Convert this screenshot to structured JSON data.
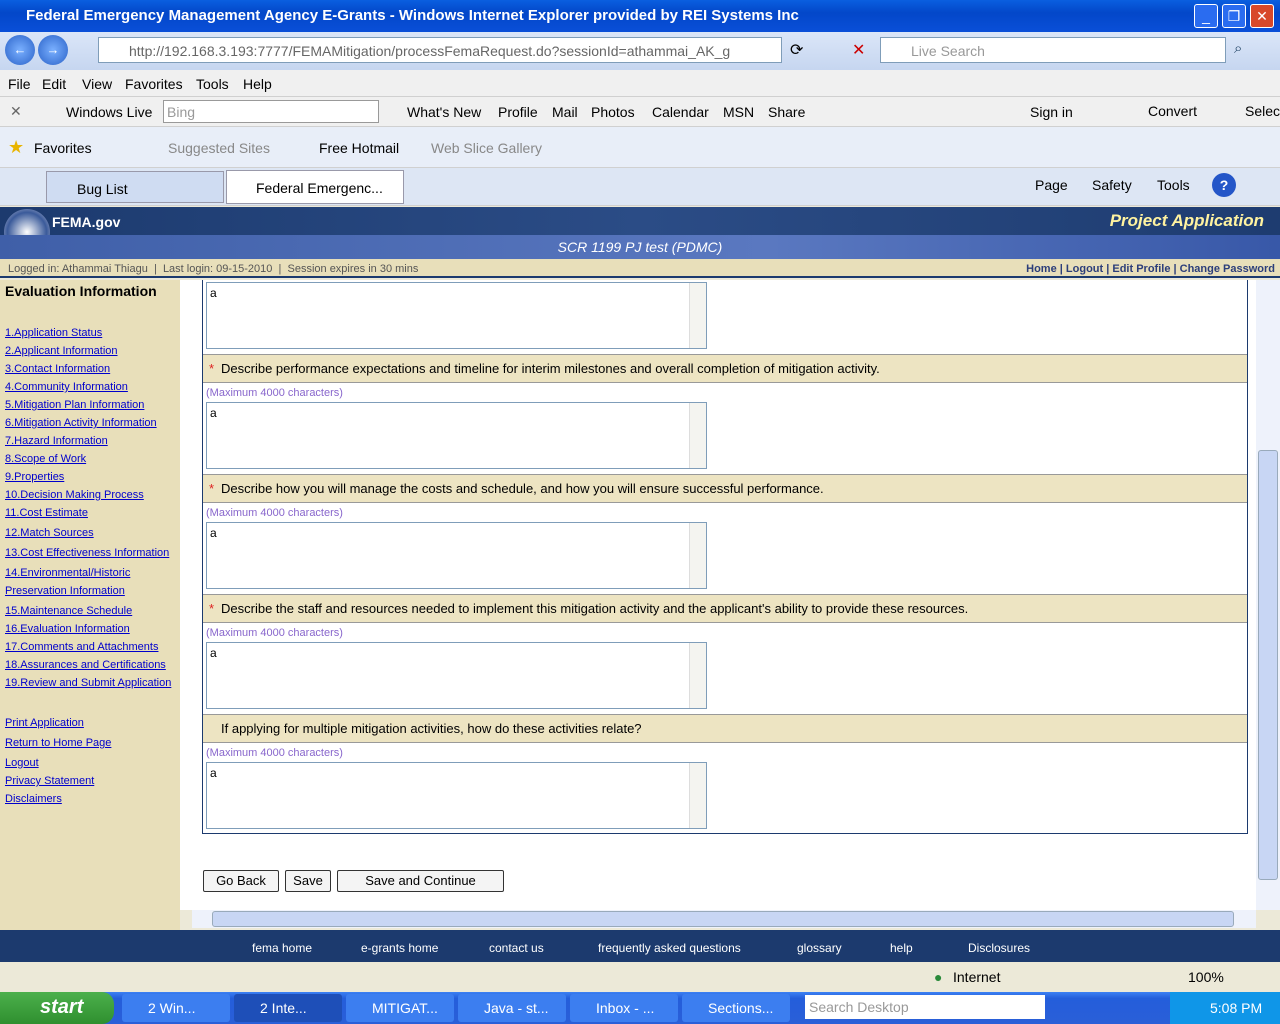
{
  "window": {
    "title": "Federal Emergency Management Agency E-Grants - Windows Internet Explorer provided by REI Systems Inc"
  },
  "address": {
    "url": "http://192.168.3.193:7777/FEMAMitigation/processFemaRequest.do?sessionId=athammai_AK_g",
    "search_placeholder": "Live Search"
  },
  "menu": [
    "File",
    "Edit",
    "View",
    "Favorites",
    "Tools",
    "Help"
  ],
  "live_toolbar": {
    "brand": "Windows Live",
    "search_placeholder": "Bing",
    "items": [
      "What's New",
      "Profile",
      "Mail",
      "Photos",
      "Calendar",
      "MSN",
      "Share"
    ],
    "sign_in": "Sign in",
    "convert": "Convert",
    "select": "Selec"
  },
  "favorites_bar": {
    "favorites": "Favorites",
    "items": [
      "Suggested Sites",
      "Free Hotmail",
      "Web Slice Gallery"
    ]
  },
  "tabs": [
    {
      "label": "Bug List"
    },
    {
      "label": "Federal Emergenc..."
    }
  ],
  "command_bar": [
    "Page",
    "Safety",
    "Tools"
  ],
  "header": {
    "logo": "FEMA.gov",
    "section": "Project Application",
    "project": "SCR 1199 PJ test (PDMC)"
  },
  "infobar": {
    "logged_in": "Logged in: Athammai Thiagu",
    "last_login": "Last login: 09-15-2010",
    "session": "Session expires in 30 mins",
    "links": [
      "Home",
      "Logout",
      "Edit Profile",
      "Change Password"
    ]
  },
  "sidebar": {
    "title": "Evaluation Information",
    "steps": [
      "1.Application Status",
      "2.Applicant Information",
      "3.Contact Information",
      "4.Community Information",
      "5.Mitigation Plan Information",
      "6.Mitigation Activity Information",
      "7.Hazard Information",
      "8.Scope of Work",
      "9.Properties",
      "10.Decision Making Process",
      "11.Cost Estimate",
      "12.Match Sources",
      "13.Cost Effectiveness Information",
      "14.Environmental/Historic Preservation Information",
      "15.Maintenance Schedule",
      "16.Evaluation Information",
      "17.Comments and Attachments",
      "18.Assurances and Certifications",
      "19.Review and Submit Application"
    ],
    "links": [
      "Print Application",
      "Return to Home Page",
      "Logout",
      "Privacy Statement",
      "Disclaimers"
    ]
  },
  "form": {
    "first_value": "a",
    "max_label": "(Maximum 4000 characters)",
    "questions": [
      {
        "text": "Describe performance expectations and timeline for interim milestones and overall completion of mitigation activity.",
        "required": true,
        "value": "a"
      },
      {
        "text": "Describe how you will manage the costs and schedule, and how you will ensure successful performance.",
        "required": true,
        "value": "a"
      },
      {
        "text": "Describe the staff and resources needed to implement this mitigation activity and the applicant's ability to provide these resources.",
        "required": true,
        "value": "a"
      },
      {
        "text": "If applying for multiple mitigation activities, how do these activities relate?",
        "required": false,
        "value": "a"
      }
    ],
    "required_mark": "*",
    "buttons": {
      "back": "Go Back",
      "save": "Save",
      "save_continue": "Save and Continue"
    }
  },
  "footer": [
    "fema home",
    "e-grants home",
    "contact us",
    "frequently asked questions",
    "glossary",
    "help",
    "Disclosures"
  ],
  "status": {
    "zone": "Internet",
    "zoom": "100%"
  },
  "taskbar": {
    "start": "start",
    "tasks": [
      "2 Win...",
      "2 Inte...",
      "MITIGAT...",
      "Java - st...",
      "Inbox - ...",
      "Sections..."
    ],
    "search_placeholder": "Search Desktop",
    "clock": "5:08 PM"
  }
}
